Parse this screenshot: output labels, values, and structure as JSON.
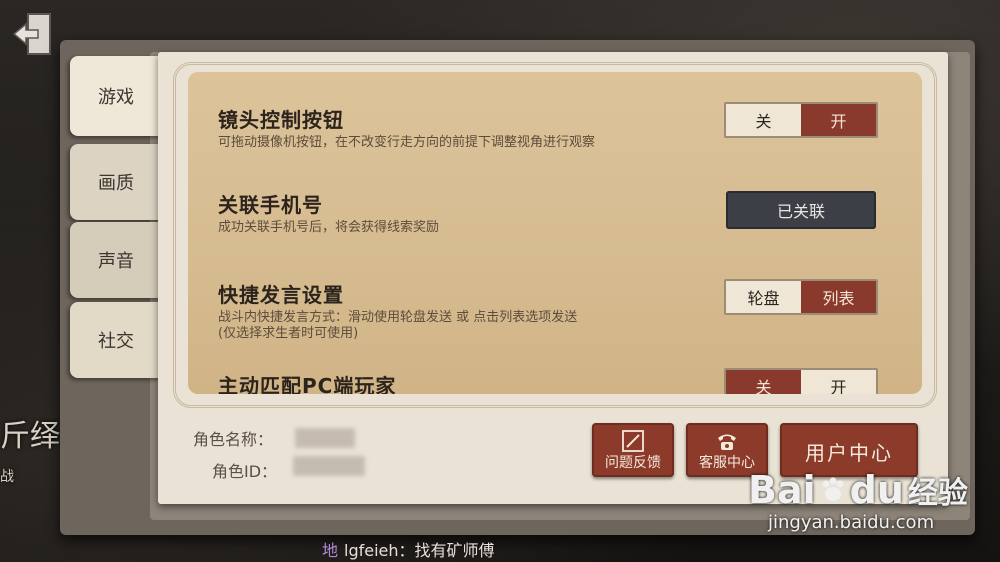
{
  "tabs": [
    {
      "label": "游戏"
    },
    {
      "label": "画质"
    },
    {
      "label": "声音"
    },
    {
      "label": "社交"
    }
  ],
  "side_text": {
    "big": "斤绎",
    "small": "战"
  },
  "settings": [
    {
      "title": "镜头控制按钮",
      "desc": "可拖动摄像机按钮，在不改变行走方向的前提下调整视角进行观察",
      "options": [
        "关",
        "开"
      ],
      "selected": "开"
    },
    {
      "title": "关联手机号",
      "desc": "成功关联手机号后，将会获得线索奖励",
      "button": "已关联"
    },
    {
      "title": "快捷发言设置",
      "desc": "战斗内快捷发言方式：滑动使用轮盘发送 或 点击列表选项发送",
      "desc2": "(仅选择求生者时可使用)",
      "options": [
        "轮盘",
        "列表"
      ],
      "selected": "列表"
    },
    {
      "title": "主动匹配PC端玩家",
      "options": [
        "关",
        "开"
      ],
      "selected": "关"
    }
  ],
  "profile": {
    "name_label": "角色名称：",
    "id_label": "角色ID："
  },
  "buttons": {
    "feedback": "问题反馈",
    "service": "客服中心",
    "user_center": "用户中心"
  },
  "watermark": {
    "brand": "Bai",
    "brand2": "du",
    "cn": "经验",
    "url": "jingyan.baidu.com"
  },
  "chat": {
    "channel": "地",
    "message": "lgfeieh：找有矿师傅"
  },
  "colors": {
    "accent": "#8a3a2c",
    "paper": "#dcc39a",
    "linked": "#3c3f46"
  }
}
